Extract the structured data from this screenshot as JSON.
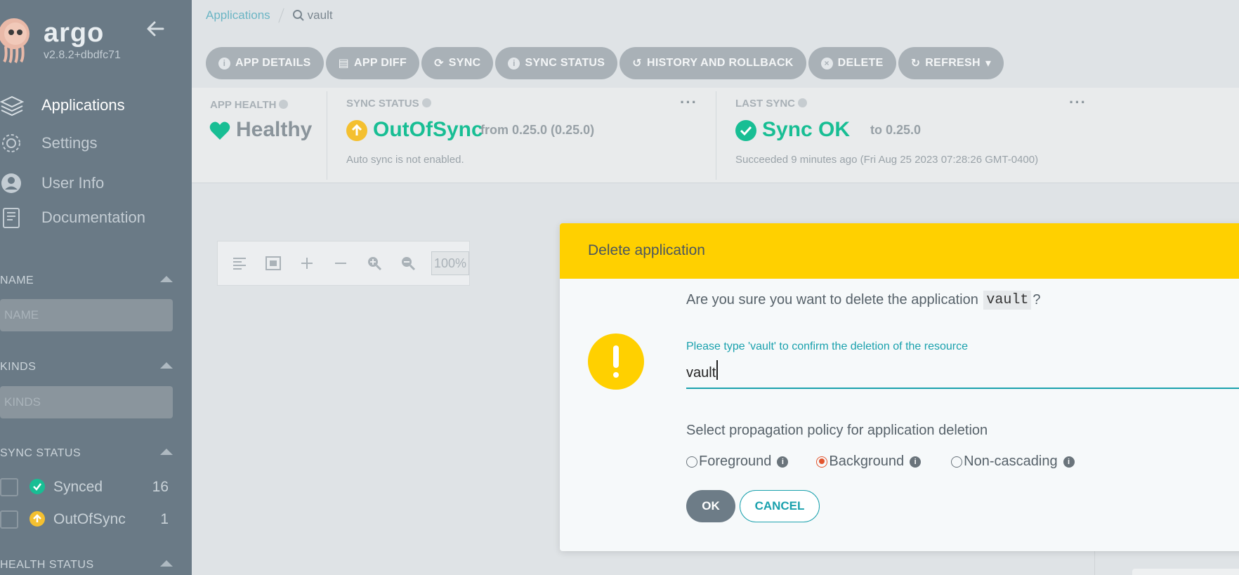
{
  "sidebar": {
    "brand": "argo",
    "version": "v2.8.2+dbdfc71",
    "nav": [
      {
        "label": "Applications",
        "icon": "layers-icon",
        "active": true
      },
      {
        "label": "Settings",
        "icon": "gear-icon"
      },
      {
        "label": "User Info",
        "icon": "user-icon"
      },
      {
        "label": "Documentation",
        "icon": "book-icon"
      }
    ],
    "filters": {
      "name": {
        "title": "NAME",
        "placeholder": "NAME"
      },
      "kinds": {
        "title": "KINDS",
        "placeholder": "KINDS"
      },
      "sync_status": {
        "title": "SYNC STATUS",
        "items": [
          {
            "label": "Synced",
            "count": "16",
            "icon": "check-circle-icon"
          },
          {
            "label": "OutOfSync",
            "count": "1",
            "icon": "arrow-up-circle-icon"
          }
        ]
      },
      "health_status": {
        "title": "HEALTH STATUS"
      }
    }
  },
  "breadcrumb": {
    "parent": "Applications",
    "current": "vault"
  },
  "toolbar": {
    "app_details": "APP DETAILS",
    "app_diff": "APP DIFF",
    "sync": "SYNC",
    "sync_status": "SYNC STATUS",
    "history": "HISTORY AND ROLLBACK",
    "delete": "DELETE",
    "refresh": "REFRESH"
  },
  "status": {
    "app_health": {
      "label": "APP HEALTH",
      "value": "Healthy",
      "color": "#18be94"
    },
    "sync_status": {
      "label": "SYNC STATUS",
      "value": "OutOfSync",
      "from": "from 0.25.0 (0.25.0)",
      "note": "Auto sync is not enabled.",
      "color": "#f4c030"
    },
    "last_sync": {
      "label": "LAST SYNC",
      "value": "Sync OK",
      "to": "to 0.25.0",
      "note": "Succeeded 9 minutes ago (Fri Aug 25 2023 07:28:26 GMT-0400)",
      "color": "#18be94"
    }
  },
  "graph_controls": {
    "zoom": "100%"
  },
  "modal": {
    "title": "Delete application",
    "question_prefix": "Are you sure you want to delete the application",
    "app_name": "vault",
    "question_suffix": "?",
    "confirm_label": "Please type 'vault' to confirm the deletion of the resource",
    "confirm_value": "vault",
    "policy_title": "Select propagation policy for application deletion",
    "policies": [
      {
        "label": "Foreground",
        "selected": false
      },
      {
        "label": "Background",
        "selected": true
      },
      {
        "label": "Non-cascading",
        "selected": false
      }
    ],
    "ok": "OK",
    "cancel": "CANCEL",
    "accent_color": "#ffd000"
  }
}
